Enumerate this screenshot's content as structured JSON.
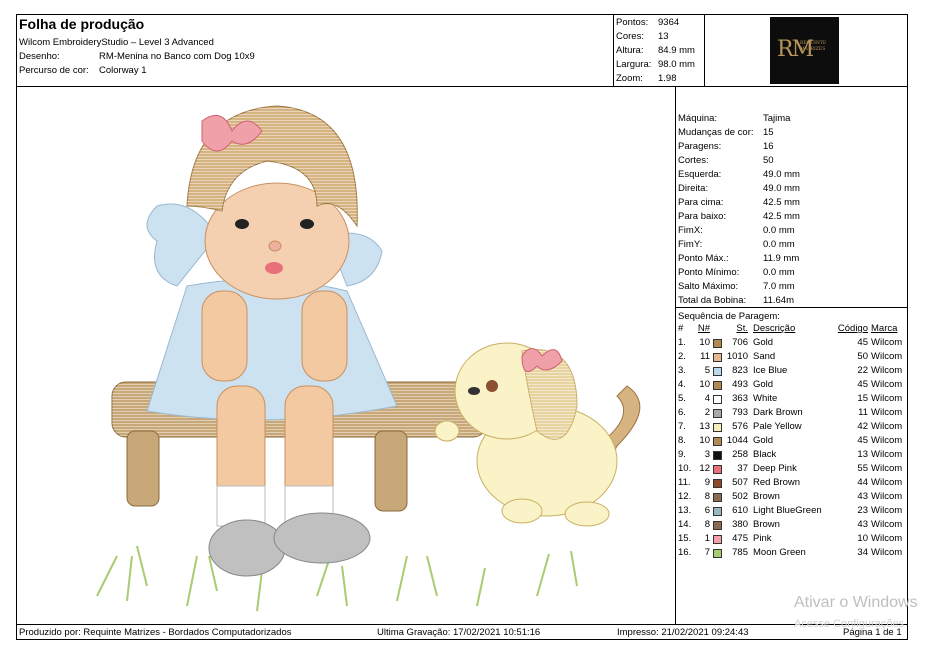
{
  "header": {
    "title": "Folha de produção",
    "software": "Wilcom EmbroideryStudio – Level 3 Advanced",
    "design_label": "Desenho:",
    "design_value": "RM-Menina no Banco com Dog 10x9",
    "colorway_label": "Percurso de cor:",
    "colorway_value": "Colorway 1"
  },
  "stats": {
    "points_label": "Pontos:",
    "points_value": "9364",
    "colors_label": "Cores:",
    "colors_value": "13",
    "height_label": "Altura:",
    "height_value": "84.9 mm",
    "width_label": "Largura:",
    "width_value": "98.0 mm",
    "zoom_label": "Zoom:",
    "zoom_value": "1.98"
  },
  "logo": {
    "mark": "RM",
    "text": "REQUINTE MATRIZES"
  },
  "machine": [
    {
      "label": "Máquina:",
      "value": "Tajima"
    },
    {
      "label": "Mudanças de cor:",
      "value": "15"
    },
    {
      "label": "Paragens:",
      "value": "16"
    },
    {
      "label": "Cortes:",
      "value": "50"
    },
    {
      "label": "Esquerda:",
      "value": "49.0 mm"
    },
    {
      "label": "Direita:",
      "value": "49.0 mm"
    },
    {
      "label": "Para cima:",
      "value": "42.5 mm"
    },
    {
      "label": "Para baixo:",
      "value": "42.5 mm"
    },
    {
      "label": "FimX:",
      "value": "0.0 mm"
    },
    {
      "label": "FimY:",
      "value": "0.0 mm"
    },
    {
      "label": "Ponto Máx.:",
      "value": "11.9 mm"
    },
    {
      "label": "Ponto Mínimo:",
      "value": "0.0 mm"
    },
    {
      "label": "Salto Máximo:",
      "value": "7.0 mm"
    },
    {
      "label": "Total da Bobina:",
      "value": "11.64m"
    }
  ],
  "sequence": {
    "title": "Sequência de Paragem:",
    "headers": {
      "idx": "#",
      "n": "N#",
      "st": "St.",
      "desc": "Descrição",
      "code": "Código",
      "brand": "Marca"
    },
    "rows": [
      {
        "idx": "1.",
        "n": "10",
        "color": "#b08a52",
        "st": "706",
        "desc": "Gold",
        "code": "45",
        "brand": "Wilcom"
      },
      {
        "idx": "2.",
        "n": "11",
        "color": "#e8b88a",
        "st": "1010",
        "desc": "Sand",
        "code": "50",
        "brand": "Wilcom"
      },
      {
        "idx": "3.",
        "n": "5",
        "color": "#bcd8ec",
        "st": "823",
        "desc": "Ice Blue",
        "code": "22",
        "brand": "Wilcom"
      },
      {
        "idx": "4.",
        "n": "10",
        "color": "#b08a52",
        "st": "493",
        "desc": "Gold",
        "code": "45",
        "brand": "Wilcom"
      },
      {
        "idx": "5.",
        "n": "4",
        "color": "#ffffff",
        "st": "363",
        "desc": "White",
        "code": "15",
        "brand": "Wilcom"
      },
      {
        "idx": "6.",
        "n": "2",
        "color": "#a8a8a8",
        "st": "793",
        "desc": "Dark Brown",
        "code": "11",
        "brand": "Wilcom"
      },
      {
        "idx": "7.",
        "n": "13",
        "color": "#f6f0b8",
        "st": "576",
        "desc": "Pale Yellow",
        "code": "42",
        "brand": "Wilcom"
      },
      {
        "idx": "8.",
        "n": "10",
        "color": "#b08a52",
        "st": "1044",
        "desc": "Gold",
        "code": "45",
        "brand": "Wilcom"
      },
      {
        "idx": "9.",
        "n": "3",
        "color": "#111111",
        "st": "258",
        "desc": "Black",
        "code": "13",
        "brand": "Wilcom"
      },
      {
        "idx": "10.",
        "n": "12",
        "color": "#e8707a",
        "st": "37",
        "desc": "Deep Pink",
        "code": "55",
        "brand": "Wilcom"
      },
      {
        "idx": "11.",
        "n": "9",
        "color": "#8a4a2a",
        "st": "507",
        "desc": "Red Brown",
        "code": "44",
        "brand": "Wilcom"
      },
      {
        "idx": "12.",
        "n": "8",
        "color": "#8a6a50",
        "st": "502",
        "desc": "Brown",
        "code": "43",
        "brand": "Wilcom"
      },
      {
        "idx": "13.",
        "n": "6",
        "color": "#9ab8c4",
        "st": "610",
        "desc": "Light BlueGreen",
        "code": "23",
        "brand": "Wilcom"
      },
      {
        "idx": "14.",
        "n": "8",
        "color": "#8a6a50",
        "st": "380",
        "desc": "Brown",
        "code": "43",
        "brand": "Wilcom"
      },
      {
        "idx": "15.",
        "n": "1",
        "color": "#f4a0a8",
        "st": "475",
        "desc": "Pink",
        "code": "10",
        "brand": "Wilcom"
      },
      {
        "idx": "16.",
        "n": "7",
        "color": "#a8cc70",
        "st": "785",
        "desc": "Moon Green",
        "code": "34",
        "brand": "Wilcom"
      }
    ]
  },
  "footer": {
    "produced": "Produzido por: Requinte Matrizes - Bordados Computadorizados",
    "last_saved": "Ultima Gravação: 17/02/2021 10:51:16",
    "printed": "Impresso: 21/02/2021 09:24:43",
    "page": "Página 1 de 1"
  },
  "watermark": {
    "line1": "Ativar o Windows",
    "line2": "Acesse Configurações"
  },
  "colors": {
    "hair": "#b08a52",
    "skin": "#e8b88a",
    "dress": "#bcd8ec",
    "bow": "#f4a0a8",
    "bench": "#b08a52",
    "dog": "#f6f0b8",
    "shoe": "#a8a8a8",
    "grass": "#a8cc70"
  }
}
